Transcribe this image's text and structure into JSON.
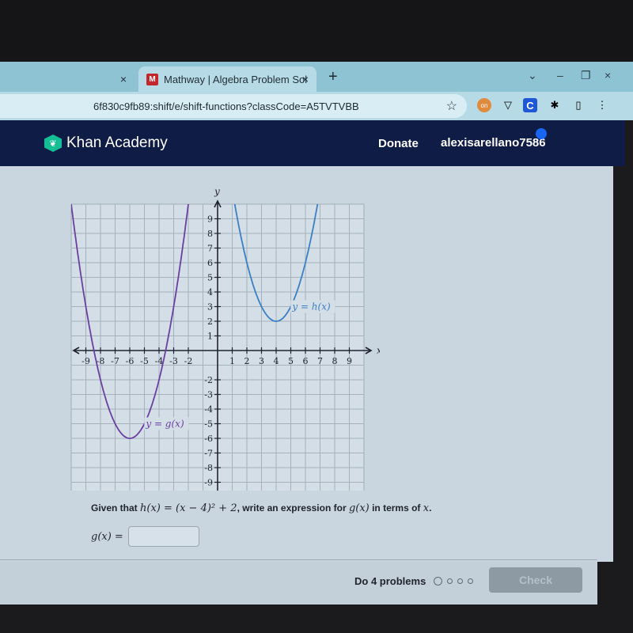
{
  "browser": {
    "tabs": [
      {
        "label": "",
        "active": false
      },
      {
        "label": "Mathway | Algebra Problem Sol",
        "active": true,
        "favicon": "M"
      }
    ],
    "new_tab_label": "+",
    "close_glyph": "×",
    "window_controls": [
      "⌄",
      "–",
      "❐",
      "×"
    ],
    "url": "6f830c9fb89:shift/e/shift-functions?classCode=A5TVTVBB",
    "bookmark_icon": "☆",
    "extensions": [
      "on",
      "▽",
      "C",
      "✱",
      "▯",
      "⋮"
    ]
  },
  "header": {
    "brand": "Khan Academy",
    "donate_label": "Donate",
    "username": "alexisarellano7586"
  },
  "graph": {
    "x_axis_label": "x",
    "y_axis_label": "y",
    "x_ticks": [
      -9,
      -8,
      -7,
      -6,
      -5,
      -4,
      -3,
      -2,
      1,
      2,
      3,
      4,
      5,
      6,
      7,
      8,
      9
    ],
    "y_ticks": [
      9,
      8,
      7,
      6,
      5,
      4,
      3,
      2,
      1,
      -2,
      -3,
      -4,
      -5,
      -6,
      -7,
      -8,
      -9
    ],
    "range": {
      "xmin": -10,
      "xmax": 10,
      "ymin": -10,
      "ymax": 10
    },
    "curves": [
      {
        "name": "h",
        "label": "y = h(x)",
        "vertex": [
          4,
          2
        ],
        "a": 1,
        "color": "#3b7fc4"
      },
      {
        "name": "g",
        "label": "y = g(x)",
        "vertex": [
          -6,
          -6
        ],
        "a": 1,
        "color": "#6b3fa0"
      }
    ]
  },
  "question": {
    "prefix": "Given that ",
    "given": "h(x) = (x − 4)² + 2",
    "middle": ", write an expression for ",
    "target": "g(x)",
    "suffix": " in terms of ",
    "var": "x",
    "end": "."
  },
  "answer": {
    "label": "g(x) =",
    "value": "",
    "placeholder": ""
  },
  "footer": {
    "progress_label": "Do 4 problems",
    "total": 4,
    "completed": 0,
    "check_label": "Check"
  }
}
